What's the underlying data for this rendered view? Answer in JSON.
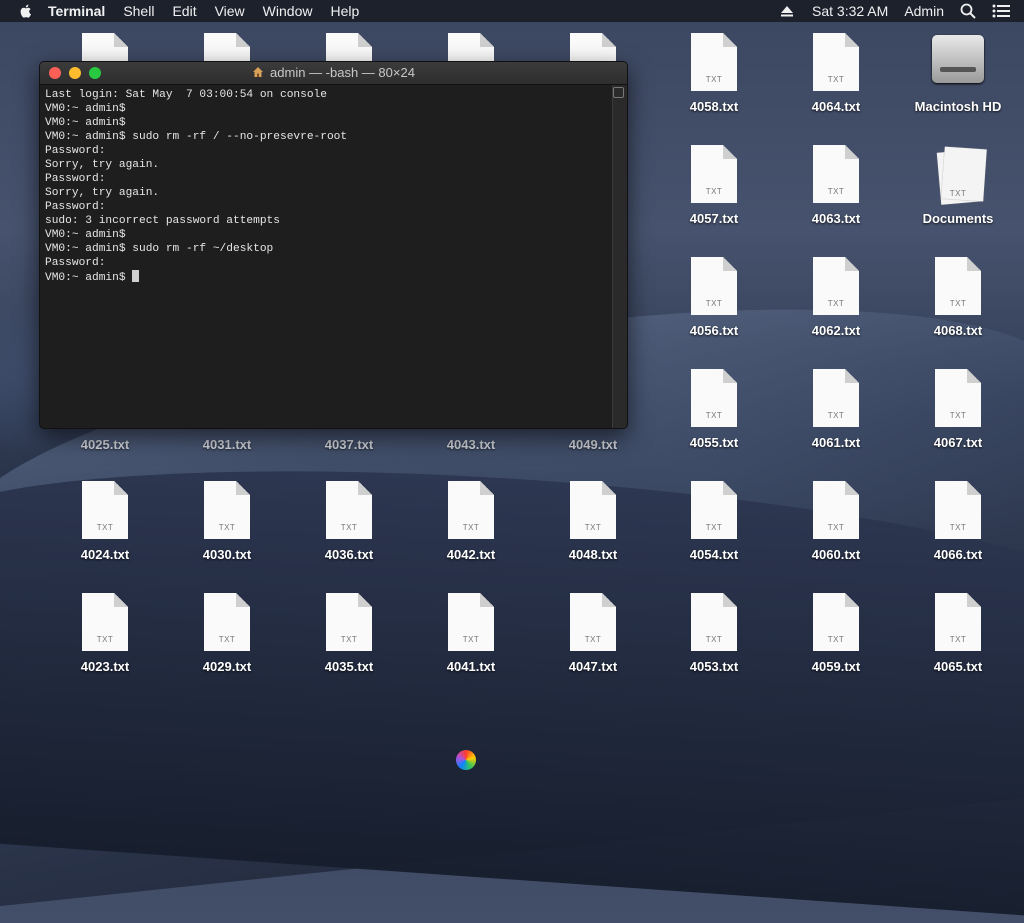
{
  "menubar": {
    "app": "Terminal",
    "items": [
      "Shell",
      "Edit",
      "View",
      "Window",
      "Help"
    ],
    "clock": "Sat 3:32 AM",
    "user": "Admin"
  },
  "terminal": {
    "title": "admin — -bash — 80×24",
    "lines": [
      "Last login: Sat May  7 03:00:54 on console",
      "VM0:~ admin$",
      "VM0:~ admin$",
      "VM0:~ admin$ sudo rm -rf / --no-presevre-root",
      "Password:",
      "Sorry, try again.",
      "Password:",
      "Sorry, try again.",
      "Password:",
      "sudo: 3 incorrect password attempts",
      "VM0:~ admin$",
      "VM0:~ admin$ sudo rm -rf ~/desktop",
      "Password:",
      "VM0:~ admin$ "
    ]
  },
  "desktop": {
    "txt_badge": "TXT",
    "icons": {
      "c1": [
        "4025.txt",
        "4024.txt",
        "4023.txt"
      ],
      "c2": [
        "4031.txt",
        "4030.txt",
        "4029.txt"
      ],
      "c3": [
        "4037.txt",
        "4036.txt",
        "4035.txt"
      ],
      "c4": [
        "4043.txt",
        "4042.txt",
        "4041.txt"
      ],
      "c5": [
        "4049.txt",
        "4048.txt",
        "4047.txt"
      ],
      "c6": [
        "4058.txt",
        "4057.txt",
        "4056.txt",
        "4055.txt",
        "4054.txt",
        "4053.txt"
      ],
      "c7": [
        "4064.txt",
        "4063.txt",
        "4062.txt",
        "4061.txt",
        "4060.txt",
        "4059.txt"
      ],
      "c8": [
        "Macintosh HD",
        "Documents",
        "4068.txt",
        "4067.txt",
        "4066.txt",
        "4065.txt"
      ]
    }
  }
}
